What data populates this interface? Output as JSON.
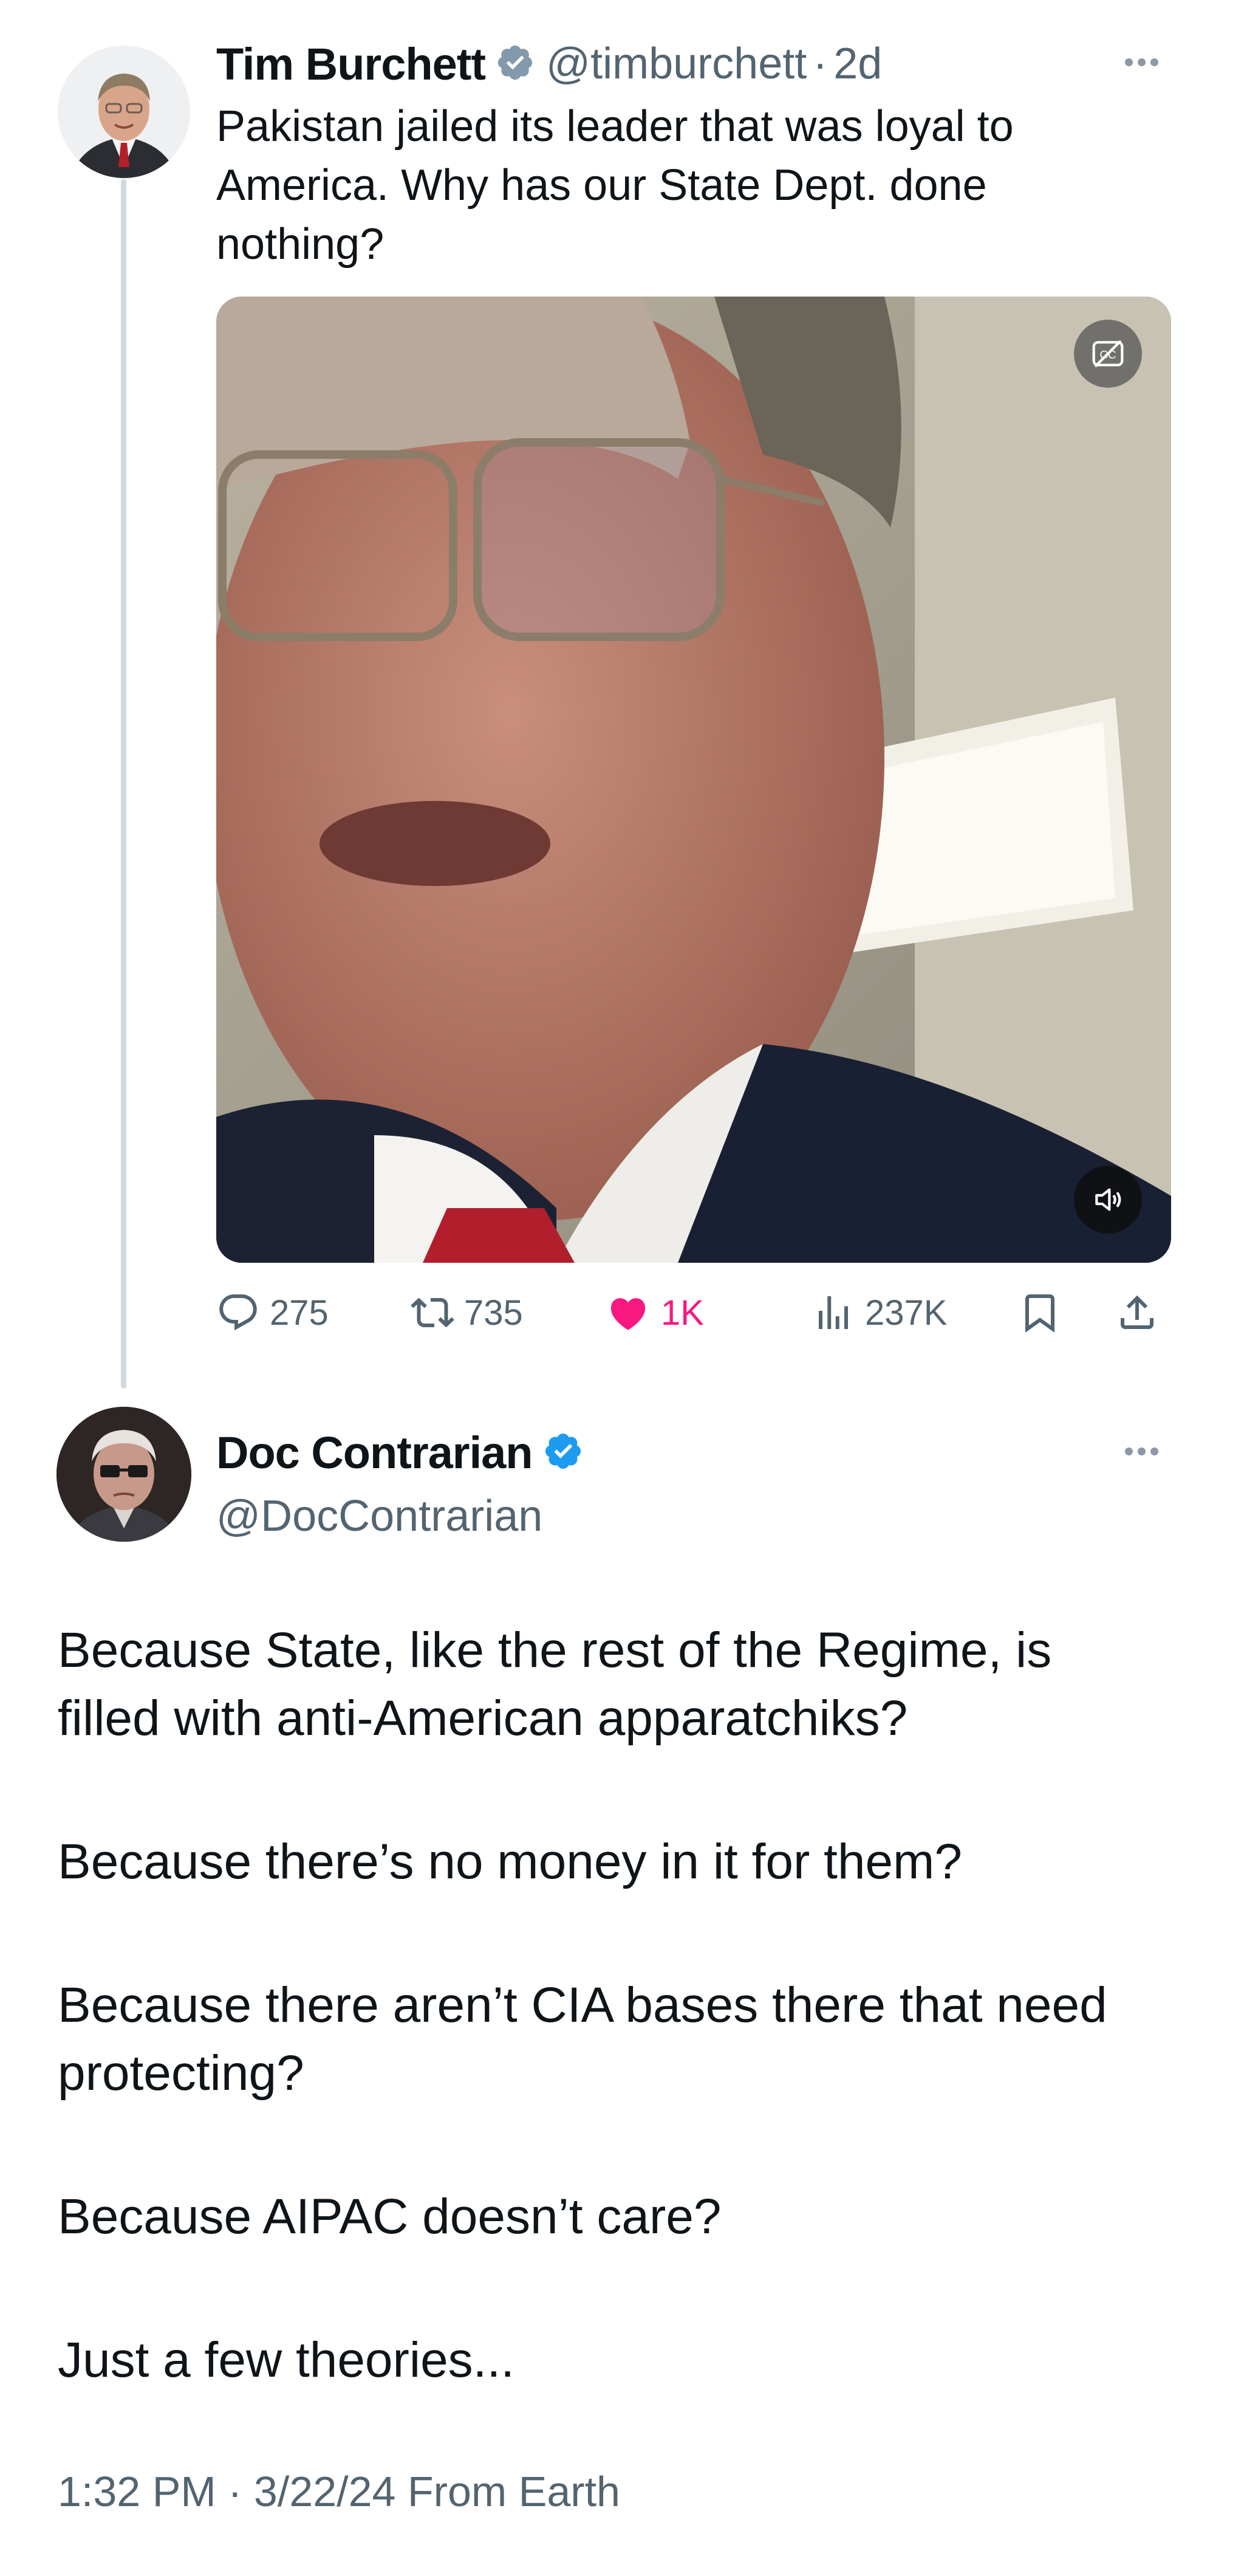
{
  "parent_tweet": {
    "author_name": "Tim Burchett",
    "handle": "@timburchett",
    "separator": "·",
    "time": "2d",
    "text_lines": [
      "Pakistan jailed its leader that was loyal to",
      "America. Why has our State Dept. done",
      "nothing?"
    ],
    "stats": {
      "replies": "275",
      "reposts": "735",
      "likes": "1K",
      "views": "237K"
    }
  },
  "reply_tweet": {
    "author_name": "Doc Contrarian",
    "handle": "@DocContrarian",
    "paragraphs": [
      [
        "Because State, like the rest of the Regime, is",
        "filled with anti-American apparatchiks?"
      ],
      [
        "Because there’s no money in it for them?"
      ],
      [
        "Because there aren’t CIA bases there that need",
        "protecting?"
      ],
      [
        "Because AIPAC doesn’t care?"
      ],
      [
        "Just a few theories..."
      ]
    ],
    "timestamp": "1:32 PM · 3/22/24 From Earth"
  },
  "colors": {
    "text_primary": "#0f1419",
    "text_secondary": "#536471",
    "verified_blue": "#1d9bf0",
    "verified_gray": "#829aab",
    "like_pink": "#f91880",
    "thread_line": "#cfd9de"
  },
  "icons": {
    "verified": "verified-badge-icon",
    "more": "more-dots-icon",
    "reply": "reply-bubble-icon",
    "repost": "repost-arrows-icon",
    "like": "heart-icon",
    "views": "bar-chart-icon",
    "bookmark": "bookmark-icon",
    "share": "share-upload-icon",
    "captions": "closed-captions-icon",
    "volume": "speaker-icon"
  }
}
